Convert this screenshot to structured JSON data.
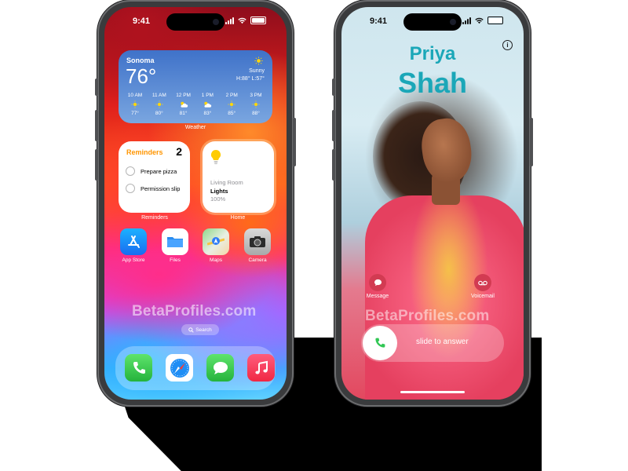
{
  "colors": {
    "reminders_accent": "#ff9500",
    "caller_name": "#1ba7b8",
    "phone_green": "#31c754",
    "weather_blue": "#3f72c9"
  },
  "left_phone": {
    "status": {
      "time": "9:41"
    },
    "weather": {
      "city": "Sonoma",
      "temp": "76°",
      "condition": "Sunny",
      "hilo": "H:88° L:57°",
      "label": "Weather",
      "hours": [
        {
          "time": "10 AM",
          "icon": "sun-icon",
          "temp": "77°"
        },
        {
          "time": "11 AM",
          "icon": "sun-icon",
          "temp": "80°"
        },
        {
          "time": "12 PM",
          "icon": "partly-cloudy-icon",
          "temp": "81°"
        },
        {
          "time": "1 PM",
          "icon": "partly-cloudy-icon",
          "temp": "83°"
        },
        {
          "time": "2 PM",
          "icon": "sun-icon",
          "temp": "85°"
        },
        {
          "time": "3 PM",
          "icon": "sun-icon",
          "temp": "88°"
        }
      ]
    },
    "reminders": {
      "title": "Reminders",
      "count": "2",
      "items": [
        "Prepare pizza",
        "Permission slip"
      ],
      "label": "Reminders"
    },
    "home": {
      "room": "Living Room",
      "accessory": "Lights",
      "level": "100%",
      "label": "Home"
    },
    "apps": [
      {
        "name": "App Store",
        "icon": "app-store-icon"
      },
      {
        "name": "Files",
        "icon": "files-icon"
      },
      {
        "name": "Maps",
        "icon": "maps-icon"
      },
      {
        "name": "Camera",
        "icon": "camera-icon"
      }
    ],
    "watermark": "BetaProfiles.com",
    "search": "Search",
    "dock": [
      "phone-icon",
      "safari-icon",
      "messages-icon",
      "music-icon"
    ]
  },
  "right_phone": {
    "status": {
      "time": "9:41"
    },
    "caller": {
      "first_name": "Priya",
      "last_name": "Shah"
    },
    "info": "i",
    "actions": {
      "message": "Message",
      "voicemail": "Voicemail"
    },
    "watermark": "BetaProfiles.com",
    "slider_text": "slide to answer"
  }
}
